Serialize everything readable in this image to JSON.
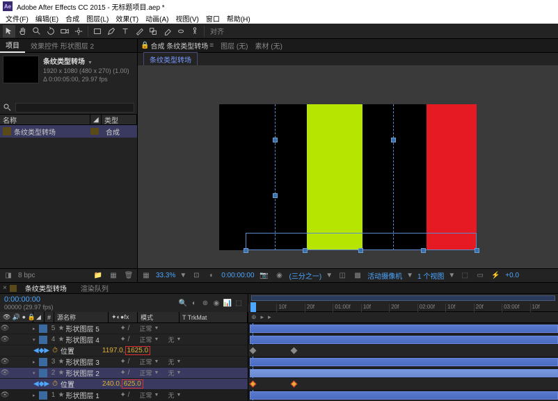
{
  "title": "Adobe After Effects CC 2015 - 无标题项目.aep *",
  "menu": [
    "文件(F)",
    "编辑(E)",
    "合成",
    "图层(L)",
    "效果(T)",
    "动画(A)",
    "视图(V)",
    "窗口",
    "帮助(H)"
  ],
  "toolbar": {
    "label": "对齐"
  },
  "project": {
    "tab": "项目",
    "effects_tab": "效果控件 形状图层 2",
    "name": "条纹类型转场",
    "dims": "1920 x 1080    (480 x 270) (1.00)",
    "duration": "Δ 0:00:05:00, 29.97 fps",
    "head_name": "名称",
    "head_type": "类型",
    "item": "条纹类型转场",
    "item_type": "合成",
    "bpc": "8 bpc"
  },
  "comp": {
    "lock_tab": "合成 条纹类型转场",
    "layer": "图层 (无)",
    "source": "素材 (无)",
    "subtab": "条纹类型转场"
  },
  "viewport": {
    "zoom": "33.3%",
    "res": "(三分之一)",
    "time": "0:00:00:00",
    "camera": "活动摄像机",
    "view": "1 个视图",
    "custview": "+0.0"
  },
  "timeline": {
    "tab": "条纹类型转场",
    "queue": "渲染队列",
    "time": "0:00:00:00",
    "fps": "00000 (29.97 fps)",
    "head": {
      "source": "源名称",
      "mode": "模式",
      "trkmat": "T  TrkMat"
    },
    "marks": [
      "",
      "10f",
      "20f",
      "01:00f",
      "10f",
      "20f",
      "02:00f",
      "10f",
      "20f",
      "03:00f",
      "10f"
    ],
    "layers": [
      {
        "num": "5",
        "name": "形状图层 5",
        "mode": "正常"
      },
      {
        "num": "4",
        "name": "形状图层 4",
        "mode": "正常",
        "trkmat": "无"
      },
      {
        "prop": "位置",
        "val1": "1197.0",
        "val2": "1625.0"
      },
      {
        "num": "3",
        "name": "形状图层 3",
        "mode": "正常",
        "trkmat": "无"
      },
      {
        "num": "2",
        "name": "形状图层 2",
        "mode": "正常",
        "trkmat": "无"
      },
      {
        "prop": "位置",
        "val1": "240.0",
        "val2": "625.0"
      },
      {
        "num": "1",
        "name": "形状图层 1",
        "mode": "正常",
        "trkmat": "无"
      }
    ]
  }
}
